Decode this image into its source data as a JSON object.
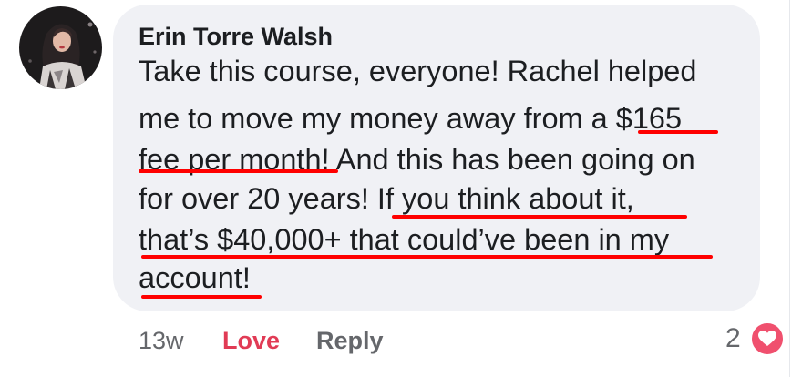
{
  "comment": {
    "author": "Erin Torre Walsh",
    "body_lines": [
      "Take this course, everyone! Rachel helped",
      "me to move my money away from a $165",
      "fee per month! And this has been going on",
      "for over 20 years! If you think about it,",
      "that’s $40,000+ that could’ve been in my",
      "account!"
    ],
    "timestamp": "13w",
    "love_label": "Love",
    "reply_label": "Reply",
    "reaction_count": "2",
    "reaction_icon": "heart-icon"
  },
  "colors": {
    "bubble_bg": "#f0f1f5",
    "love": "#e13b55",
    "annotation": "#ff0000",
    "heart_badge": "#f0506e"
  }
}
